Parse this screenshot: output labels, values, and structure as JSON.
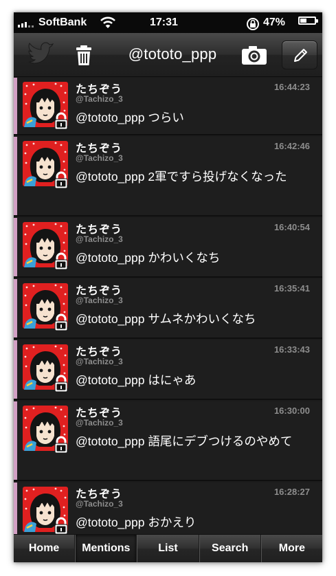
{
  "status_bar": {
    "carrier": "SoftBank",
    "time": "17:31",
    "battery_percent": "47%",
    "battery_level": 0.47
  },
  "nav": {
    "title": "@tototo_ppp"
  },
  "tweets": [
    {
      "name": "たちぞう",
      "handle": "@Tachizo_3",
      "time": "16:44:23",
      "text": "@tototo_ppp つらい"
    },
    {
      "name": "たちぞう",
      "handle": "@Tachizo_3",
      "time": "16:42:46",
      "text": "@tototo_ppp 2軍ですら投げなくなった"
    },
    {
      "name": "たちぞう",
      "handle": "@Tachizo_3",
      "time": "16:40:54",
      "text": "@tototo_ppp かわいくなち"
    },
    {
      "name": "たちぞう",
      "handle": "@Tachizo_3",
      "time": "16:35:41",
      "text": "@tototo_ppp サムネかわいくなち"
    },
    {
      "name": "たちぞう",
      "handle": "@Tachizo_3",
      "time": "16:33:43",
      "text": "@tototo_ppp はにゃあ"
    },
    {
      "name": "たちぞう",
      "handle": "@Tachizo_3",
      "time": "16:30:00",
      "text": "@tototo_ppp 語尾にデブつけるのやめて"
    },
    {
      "name": "たちぞう",
      "handle": "@Tachizo_3",
      "time": "16:28:27",
      "text": "@tototo_ppp おかえり"
    }
  ],
  "tabs": [
    {
      "label": "Home",
      "active": false
    },
    {
      "label": "Mentions",
      "active": true
    },
    {
      "label": "List",
      "active": false
    },
    {
      "label": "Search",
      "active": false
    },
    {
      "label": "More",
      "active": false
    }
  ],
  "colors": {
    "accent_bar": "#d2a0c4",
    "avatar_bg": "#e02020",
    "secondary_text": "#8d8d8d"
  }
}
